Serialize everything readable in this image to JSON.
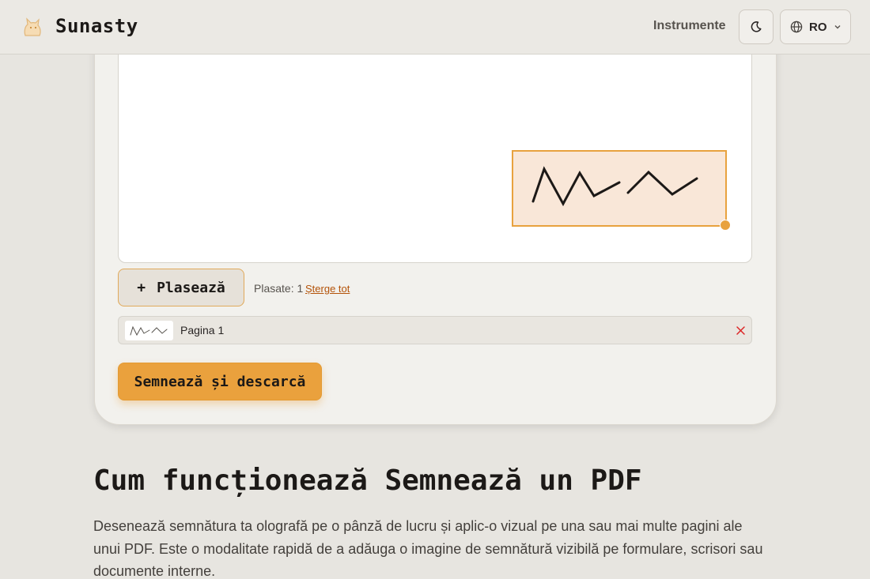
{
  "header": {
    "brand": "Sunasty",
    "nav_link": "Instrumente",
    "theme_icon": "moon-icon",
    "language": "RO",
    "language_icon": "globe-icon"
  },
  "editor": {
    "place_button": "Plasează",
    "place_icon": "plus-icon",
    "placed_count": "Plasate: 1",
    "clear_all": "Șterge tot",
    "pages": [
      {
        "label": "Pagina 1"
      }
    ],
    "sign_button": "Semnează și descarcă"
  },
  "section": {
    "title": "Cum funcționează Semnează un PDF",
    "body": "Desenează semnătura ta olografă pe o pânză de lucru și aplic-o vizual pe una sau mai multe pagini ale unui PDF. Este o modalitate rapidă de a adăuga o imagine de semnătură vizibilă pe formulare, scrisori sau documente interne."
  },
  "colors": {
    "accent": "#eaa13d",
    "background": "#e7e5e0",
    "card": "#f2f1ed",
    "link": "#b45309",
    "remove": "#dc2626"
  }
}
